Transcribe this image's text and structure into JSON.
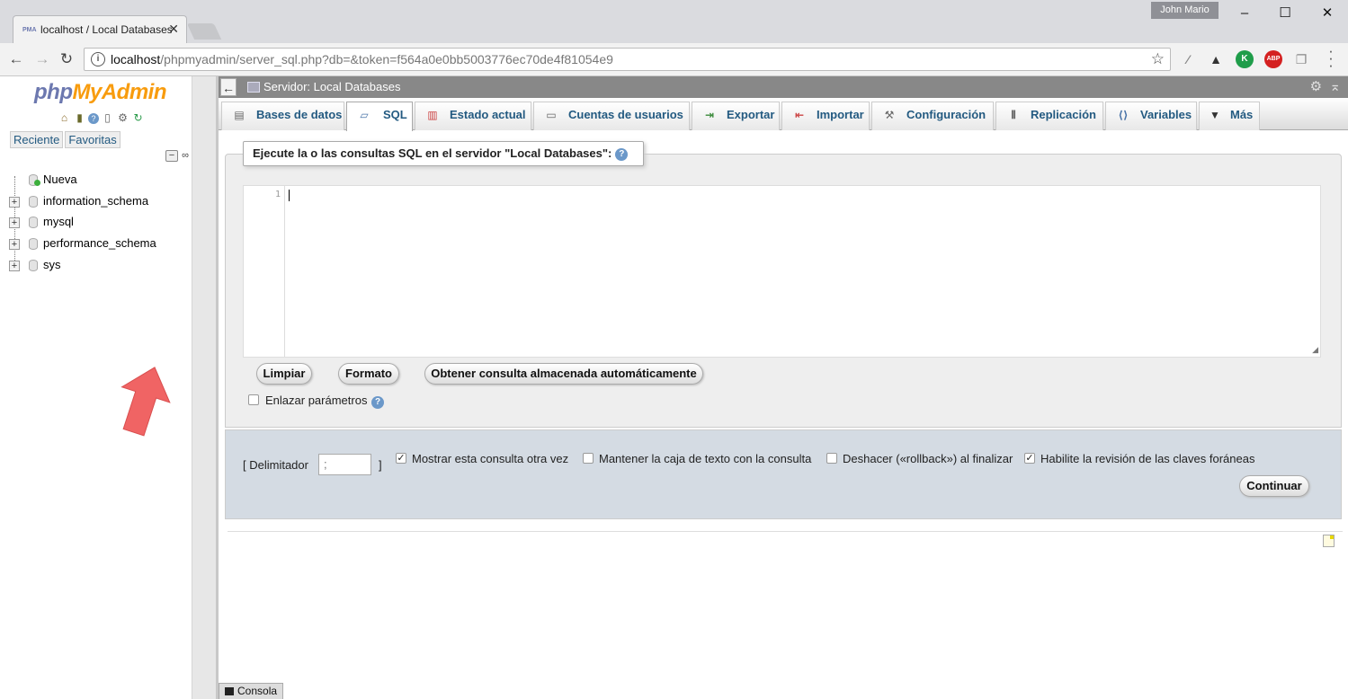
{
  "browser": {
    "tab_title": "localhost / Local Databases",
    "tab_favicon": "PMA",
    "user": "John Mario",
    "url_host": "localhost",
    "url_path": "/phpmyadmin/server_sql.php?db=&token=f564a0e0bb5003776ec70de4f81054e9",
    "extension_abp": "ABP",
    "extension_k": "K"
  },
  "nav": {
    "logo_php": "php",
    "logo_myadmin": "MyAdmin",
    "tabs": [
      "Reciente",
      "Favoritas"
    ],
    "tree": [
      {
        "label": "Nueva"
      },
      {
        "label": "information_schema"
      },
      {
        "label": "mysql"
      },
      {
        "label": "performance_schema"
      },
      {
        "label": "sys"
      }
    ]
  },
  "main": {
    "server_title": "Servidor: Local Databases",
    "tabs": [
      {
        "label": "Bases de datos"
      },
      {
        "label": "SQL"
      },
      {
        "label": "Estado actual"
      },
      {
        "label": "Cuentas de usuarios"
      },
      {
        "label": "Exportar"
      },
      {
        "label": "Importar"
      },
      {
        "label": "Configuración"
      },
      {
        "label": "Replicación"
      },
      {
        "label": "Variables"
      },
      {
        "label": "Más"
      }
    ],
    "active_tab": "SQL",
    "legend": "Ejecute la o las consultas SQL en el servidor \"Local Databases\":",
    "editor_line": "1",
    "buttons": {
      "clear": "Limpiar",
      "format": "Formato",
      "get_auto": "Obtener consulta almacenada automáticamente",
      "go": "Continuar"
    },
    "bind_params": "Enlazar parámetros",
    "delimiter_label": "[ Delimitador",
    "delimiter_close": "]",
    "delimiter_value": ";",
    "options": [
      {
        "label": "Mostrar esta consulta otra vez",
        "checked": true
      },
      {
        "label": "Mantener la caja de texto con la consulta",
        "checked": false
      },
      {
        "label": "Deshacer («rollback») al finalizar",
        "checked": false
      },
      {
        "label": "Habilite la revisión de las claves foráneas",
        "checked": true
      }
    ],
    "console": "Consola"
  },
  "colors": {
    "link_blue": "#235a81",
    "logo_php": "#6c78af",
    "logo_myadmin": "#f89c0e",
    "server_bar": "#888888",
    "options_bg": "#d4dbe3",
    "arrow": "#f06060"
  }
}
